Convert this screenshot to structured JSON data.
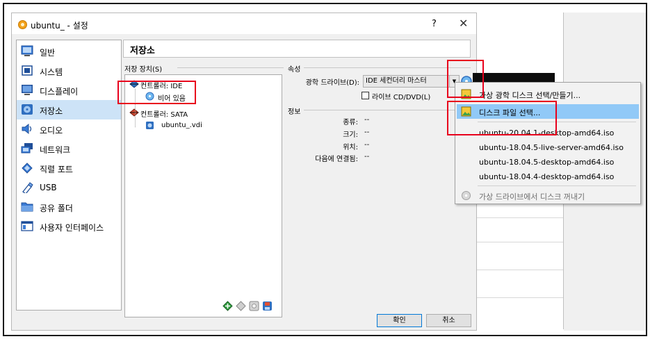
{
  "window": {
    "title": "ubuntu_ - 설정",
    "help": "?",
    "close": "✕"
  },
  "sidebar": {
    "items": [
      {
        "label": "일반",
        "icon": "general-icon"
      },
      {
        "label": "시스템",
        "icon": "chip-icon"
      },
      {
        "label": "디스플레이",
        "icon": "monitor-icon"
      },
      {
        "label": "저장소",
        "icon": "storage-icon",
        "selected": true
      },
      {
        "label": "오디오",
        "icon": "speaker-icon"
      },
      {
        "label": "네트워크",
        "icon": "network-icon"
      },
      {
        "label": "직렬 포트",
        "icon": "serial-port-icon"
      },
      {
        "label": "USB",
        "icon": "usb-icon"
      },
      {
        "label": "공유 폴더",
        "icon": "folder-icon"
      },
      {
        "label": "사용자 인터페이스",
        "icon": "ui-icon"
      }
    ]
  },
  "page": {
    "title": "저장소"
  },
  "storage": {
    "group_label": "저장 장치(S)",
    "tree": {
      "ide_controller": "컨트롤러: IDE",
      "ide_empty": "비어 있음",
      "sata_controller": "컨트롤러: SATA",
      "sata_disk": "ubuntu_.vdi"
    }
  },
  "attributes": {
    "group_label": "속성",
    "optical_drive_label": "광학 드라이브(D):",
    "optical_drive_value": "IDE 세컨더리 마스터",
    "live_cd_label": "라이브 CD/DVD(L)",
    "live_cd_checked": false
  },
  "info": {
    "group_label": "정보",
    "rows": [
      {
        "label": "종류:",
        "value": "--"
      },
      {
        "label": "크기:",
        "value": "--"
      },
      {
        "label": "위치:",
        "value": "--"
      },
      {
        "label": "다음에 연결됨:",
        "value": "--"
      }
    ]
  },
  "buttons": {
    "ok": "확인",
    "cancel": "취소"
  },
  "menu": {
    "create": "가상 광학 디스크 선택/만들기...",
    "choose_file": "디스크 파일 선택...",
    "recent": [
      "ubuntu-20.04.1-desktop-amd64.iso",
      "ubuntu-18.04.5-live-server-amd64.iso",
      "ubuntu-18.04.5-desktop-amd64.iso",
      "ubuntu-18.04.4-desktop-amd64.iso"
    ],
    "eject": "가상 드라이브에서 디스크 꺼내기"
  },
  "colors": {
    "highlight": "#e8001c",
    "selection": "#91c9f7"
  }
}
